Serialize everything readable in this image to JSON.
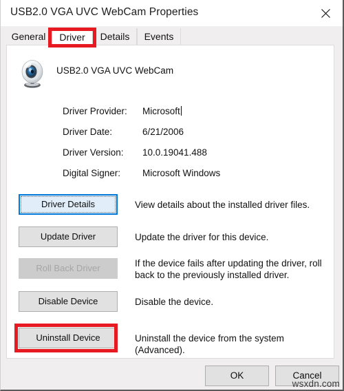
{
  "window": {
    "title": "USB2.0 VGA UVC WebCam Properties",
    "close_icon": "close-icon"
  },
  "tabs": [
    {
      "label": "General",
      "selected": false
    },
    {
      "label": "Driver",
      "selected": true
    },
    {
      "label": "Details",
      "selected": false
    },
    {
      "label": "Events",
      "selected": false
    }
  ],
  "device": {
    "icon": "webcam-icon",
    "name": "USB2.0 VGA UVC WebCam"
  },
  "driver_info": [
    {
      "label": "Driver Provider:",
      "value": "Microsoft",
      "has_caret": true
    },
    {
      "label": "Driver Date:",
      "value": "6/21/2006",
      "has_caret": false
    },
    {
      "label": "Driver Version:",
      "value": "10.0.19041.488",
      "has_caret": false
    },
    {
      "label": "Digital Signer:",
      "value": "Microsoft Windows",
      "has_caret": false
    }
  ],
  "actions": [
    {
      "button": "Driver Details",
      "description": "View details about the installed driver files.",
      "state": "focused"
    },
    {
      "button": "Update Driver",
      "description": "Update the driver for this device.",
      "state": "normal"
    },
    {
      "button": "Roll Back Driver",
      "description": "If the device fails after updating the driver, roll back to the previously installed driver.",
      "state": "disabled"
    },
    {
      "button": "Disable Device",
      "description": "Disable the device.",
      "state": "normal"
    },
    {
      "button": "Uninstall Device",
      "description": "Uninstall the device from the system (Advanced).",
      "state": "normal"
    }
  ],
  "footer": {
    "ok_label": "OK",
    "cancel_label": "Cancel"
  },
  "watermark": "wsxdn.com",
  "annotations": {
    "color": "#e81a21",
    "targets": [
      "Driver",
      "Uninstall Device"
    ]
  }
}
